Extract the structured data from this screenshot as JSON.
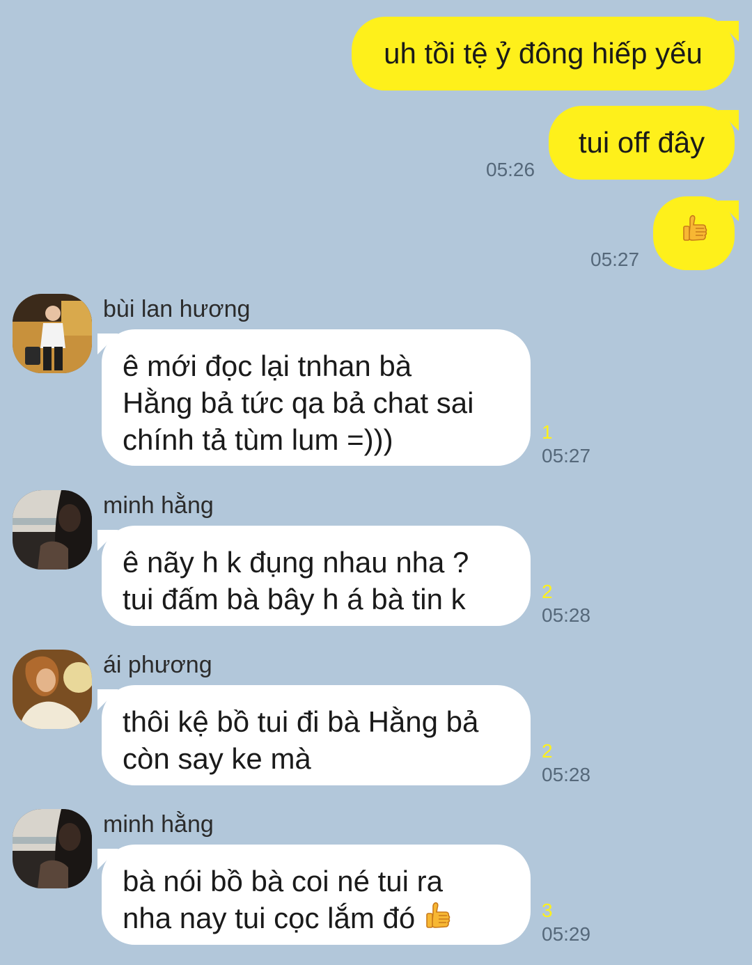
{
  "colors": {
    "background": "#b2c7da",
    "my_bubble": "#fef01b",
    "other_bubble": "#ffffff",
    "unread_count": "#fef01b"
  },
  "my_messages": [
    {
      "text": "uh tồi tệ ỷ đông hiếp yếu",
      "time": ""
    },
    {
      "text": "tui off đây",
      "time": "05:26"
    },
    {
      "emoji": "thumbs-up-icon",
      "time": "05:27"
    }
  ],
  "other_messages": [
    {
      "sender": "bùi lan hương",
      "lines": [
        "ê mới đọc lại tnhan bà",
        "Hằng bả tức qa bả chat sai",
        "chính tả tùm lum =)))"
      ],
      "unread": "1",
      "time": "05:27"
    },
    {
      "sender": "minh hằng",
      "lines": [
        "ê nãy h k đụng nhau nha ?",
        "tui đấm bà bây h á bà tin k"
      ],
      "unread": "2",
      "time": "05:28"
    },
    {
      "sender": "ái phương",
      "lines": [
        "thôi kệ bồ tui đi bà Hằng bả",
        "còn say ke mà"
      ],
      "unread": "2",
      "time": "05:28"
    },
    {
      "sender": "minh hằng",
      "lines": [
        "bà nói bồ bà coi né tui ra",
        "nha nay tui cọc lắm đó"
      ],
      "emoji": "thumbs-up-icon",
      "unread": "3",
      "time": "05:29"
    }
  ]
}
